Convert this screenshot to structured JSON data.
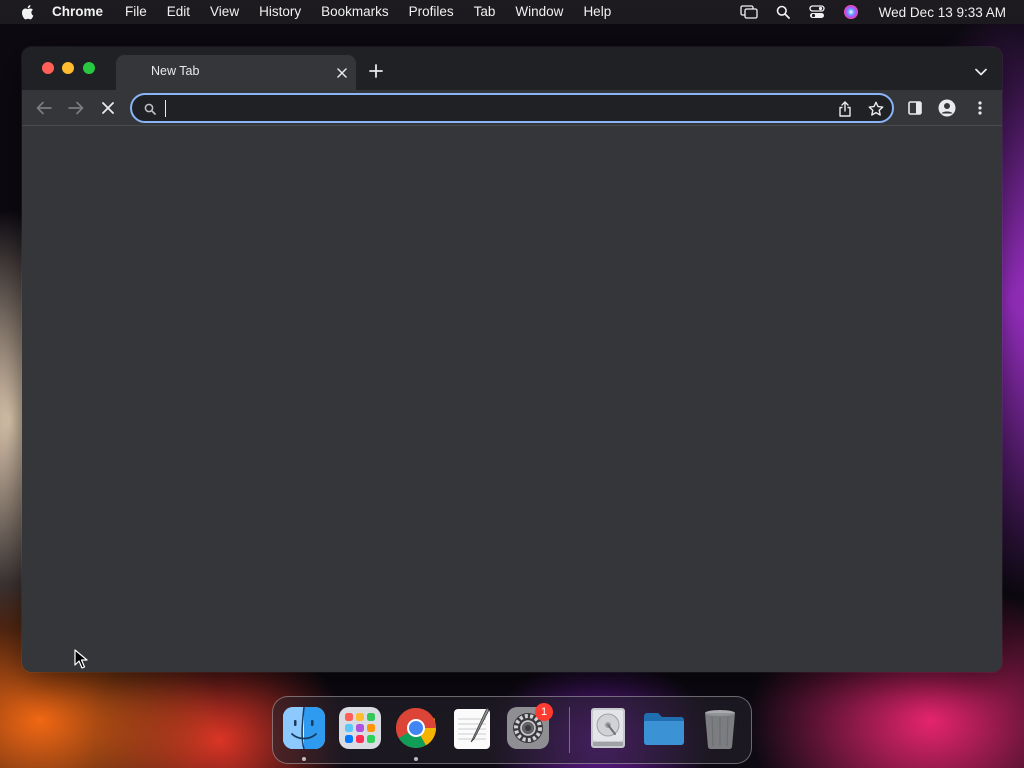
{
  "menubar": {
    "apple_icon": "apple-logo-icon",
    "app_name": "Chrome",
    "items": [
      "File",
      "Edit",
      "View",
      "History",
      "Bookmarks",
      "Profiles",
      "Tab",
      "Window",
      "Help"
    ],
    "status_icons": [
      "screen-mirroring-icon",
      "spotlight-search-icon",
      "control-center-icon",
      "siri-icon"
    ],
    "clock": "Wed Dec 13  9:33 AM"
  },
  "window": {
    "tab": {
      "title": "New Tab",
      "close_icon": "close-icon"
    },
    "new_tab_icon": "plus-icon",
    "tab_search_icon": "chevron-down-icon",
    "toolbar": {
      "back_icon": "back-arrow-icon",
      "forward_icon": "forward-arrow-icon",
      "stop_icon": "stop-loading-icon",
      "side_panel_icon": "side-panel-icon",
      "profile_icon": "profile-icon",
      "menu_icon": "more-vertical-icon"
    },
    "omnibox": {
      "value": "",
      "placeholder": "",
      "search_icon": "search-icon",
      "share_icon": "share-icon",
      "bookmark_icon": "star-icon"
    },
    "accent_color": "#8ab4f8"
  },
  "dock": {
    "items": [
      {
        "name": "Finder",
        "icon": "finder-icon",
        "running": true
      },
      {
        "name": "Launchpad",
        "icon": "launchpad-icon",
        "running": false
      },
      {
        "name": "Google Chrome",
        "icon": "chrome-icon",
        "running": true
      },
      {
        "name": "TextEdit",
        "icon": "textedit-icon",
        "running": false
      },
      {
        "name": "System Settings",
        "icon": "system-settings-icon",
        "running": false,
        "badge": "1"
      },
      {
        "name": "Disk Utility",
        "icon": "disk-icon",
        "running": false
      },
      {
        "name": "Folder",
        "icon": "folder-icon",
        "running": false
      },
      {
        "name": "Trash",
        "icon": "trash-icon",
        "running": false
      }
    ]
  }
}
